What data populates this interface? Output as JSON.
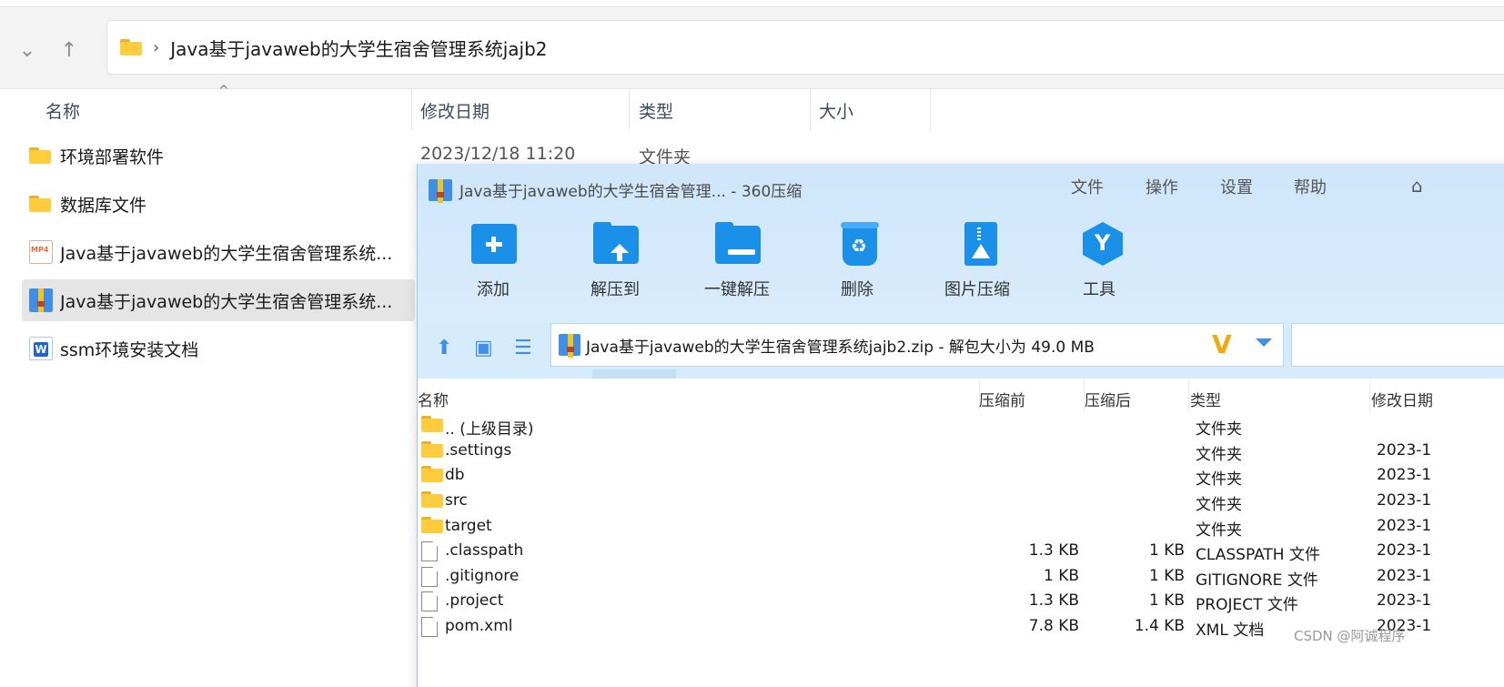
{
  "explorer": {
    "address": {
      "path": "Java基于javaweb的大学生宿舍管理系统jajb2",
      "separator": "›"
    },
    "nav": {
      "down_arrow": "⌄",
      "up_arrow": "↑"
    },
    "columns": {
      "name": "名称",
      "modified": "修改日期",
      "type": "类型",
      "size": "大小"
    },
    "sort_caret": "^",
    "items": [
      {
        "name": "环境部署软件",
        "icon": "folder-icon",
        "modified": "2023/12/18 11:20",
        "type": "文件夹"
      },
      {
        "name": "数据库文件",
        "icon": "folder-icon"
      },
      {
        "name": "Java基于javaweb的大学生宿舍管理系统...",
        "icon": "mp4-file-icon",
        "icon_text": "MP4"
      },
      {
        "name": "Java基于javaweb的大学生宿舍管理系统...",
        "icon": "zip-archive-icon",
        "selected": true
      },
      {
        "name": "ssm环境安装文档",
        "icon": "word-document-icon",
        "icon_text": "W"
      }
    ]
  },
  "zip": {
    "title": "Java基于javaweb的大学生宿舍管理... - 360压缩",
    "menu": [
      "文件",
      "操作",
      "设置",
      "帮助"
    ],
    "toolbar": [
      {
        "label": "添加",
        "icon": "add-icon"
      },
      {
        "label": "解压到",
        "icon": "extract-to-icon"
      },
      {
        "label": "一键解压",
        "icon": "one-click-extract-icon"
      },
      {
        "label": "删除",
        "icon": "delete-icon"
      },
      {
        "label": "图片压缩",
        "icon": "image-compress-icon"
      },
      {
        "label": "工具",
        "icon": "tools-icon"
      }
    ],
    "path": "Java基于javaweb的大学生宿舍管理系统jajb2.zip - 解包大小为 49.0 MB",
    "v_logo": "V",
    "columns": {
      "name": "名称",
      "before": "压缩前",
      "after": "压缩后",
      "type": "类型",
      "modified": "修改日期"
    },
    "rows": [
      {
        "name": ".. (上级目录)",
        "icon": "folder-icon",
        "before": "",
        "after": "",
        "type": "文件夹",
        "modified": ""
      },
      {
        "name": ".settings",
        "icon": "folder-icon",
        "before": "",
        "after": "",
        "type": "文件夹",
        "modified": "2023-1"
      },
      {
        "name": "db",
        "icon": "folder-icon",
        "before": "",
        "after": "",
        "type": "文件夹",
        "modified": "2023-1"
      },
      {
        "name": "src",
        "icon": "folder-icon",
        "before": "",
        "after": "",
        "type": "文件夹",
        "modified": "2023-1"
      },
      {
        "name": "target",
        "icon": "folder-icon",
        "before": "",
        "after": "",
        "type": "文件夹",
        "modified": "2023-1"
      },
      {
        "name": ".classpath",
        "icon": "file-icon",
        "before": "1.3 KB",
        "after": "1 KB",
        "type": "CLASSPATH 文件",
        "modified": "2023-1"
      },
      {
        "name": ".gitignore",
        "icon": "file-icon",
        "before": "1 KB",
        "after": "1 KB",
        "type": "GITIGNORE 文件",
        "modified": "2023-1"
      },
      {
        "name": ".project",
        "icon": "file-icon",
        "before": "1.3 KB",
        "after": "1 KB",
        "type": "PROJECT 文件",
        "modified": "2023-1"
      },
      {
        "name": "pom.xml",
        "icon": "file-icon",
        "before": "7.8 KB",
        "after": "1.4 KB",
        "type": "XML 文档",
        "modified": "2023-1"
      }
    ]
  },
  "watermark": "CSDN @阿诚程序",
  "colors": {
    "accent": "#1b90e8",
    "folder": "#ffcc3d",
    "zip_header": "#cfe6fb"
  }
}
